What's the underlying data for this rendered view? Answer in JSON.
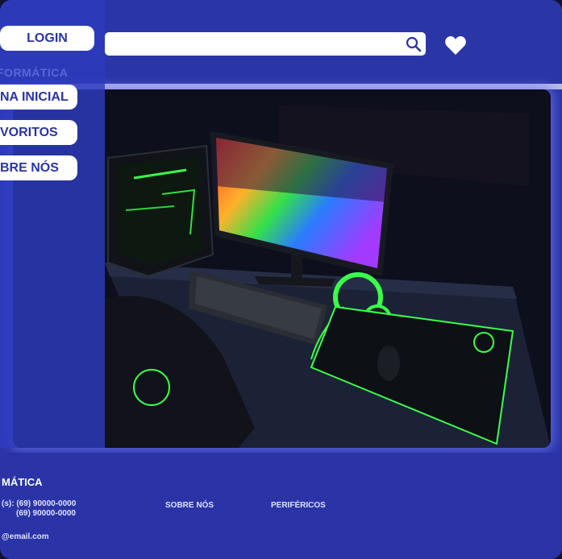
{
  "header": {
    "login_label": "LOGIN",
    "search": {
      "placeholder": ""
    },
    "favorite_icon": "heart-icon",
    "search_icon": "search-icon"
  },
  "sidebar": {
    "brand": "FORMÁTICA",
    "items": [
      {
        "label": "NA INICIAL"
      },
      {
        "label": "VORITOS"
      },
      {
        "label": "BRE NÓS"
      }
    ]
  },
  "hero": {
    "image": "gaming-setup-photo"
  },
  "footer": {
    "title": "MÁTICA",
    "phone1": "(s): (69) 90000-0000",
    "phone2": "(69) 90000-0000",
    "link_about": "SOBRE NÓS",
    "link_peripherals": "PERIFÉRICOS",
    "email": "@email.com"
  },
  "colors": {
    "primary": "#2a34a6",
    "accent": "#b7bbe9",
    "button": "#ffffff",
    "neon": "#39ff4a"
  }
}
